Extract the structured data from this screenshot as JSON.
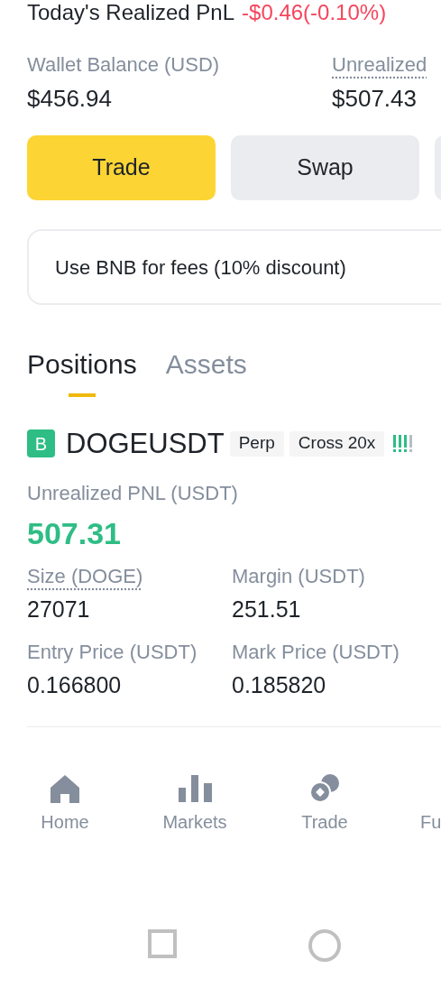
{
  "realized_pnl": {
    "label": "Today's Realized PnL",
    "value": "-$0.46(-0.10%)"
  },
  "balances": [
    {
      "label": "Wallet Balance (USD)",
      "value": "$456.94",
      "dotted": false
    },
    {
      "label": "Unrealized",
      "value": "$507.43",
      "dotted": true
    }
  ],
  "actions": [
    {
      "label": "Trade",
      "kind": "primary"
    },
    {
      "label": "Swap",
      "kind": "secondary"
    },
    {
      "kind": "secondary"
    }
  ],
  "fee_option": {
    "label": "Use BNB for fees (10% discount)"
  },
  "tabs": [
    {
      "label": "Positions",
      "selected": true
    },
    {
      "label": "Assets",
      "selected": false
    }
  ],
  "position": {
    "side": "B",
    "symbol": "DOGEUSDT",
    "tags": [
      "Perp",
      "Cross 20x"
    ],
    "risk_bars": [
      true,
      true,
      true,
      false
    ],
    "pnl_label": "Unrealized PNL (USDT)",
    "pnl_value": "507.31",
    "fields": [
      {
        "label": "Size (DOGE)",
        "value": "27071",
        "dotted": true
      },
      {
        "label": "Margin (USDT)",
        "value": "251.51",
        "dotted": false
      },
      {
        "label": "Entry Price (USDT)",
        "value": "0.166800",
        "dotted": false
      },
      {
        "label": "Mark Price (USDT)",
        "value": "0.185820",
        "dotted": false
      }
    ]
  },
  "nav": [
    {
      "label": "Home",
      "kind": "home"
    },
    {
      "label": "Markets",
      "kind": "markets"
    },
    {
      "label": "Trade",
      "kind": "trade"
    },
    {
      "label": "Fu",
      "kind": "futures"
    }
  ]
}
